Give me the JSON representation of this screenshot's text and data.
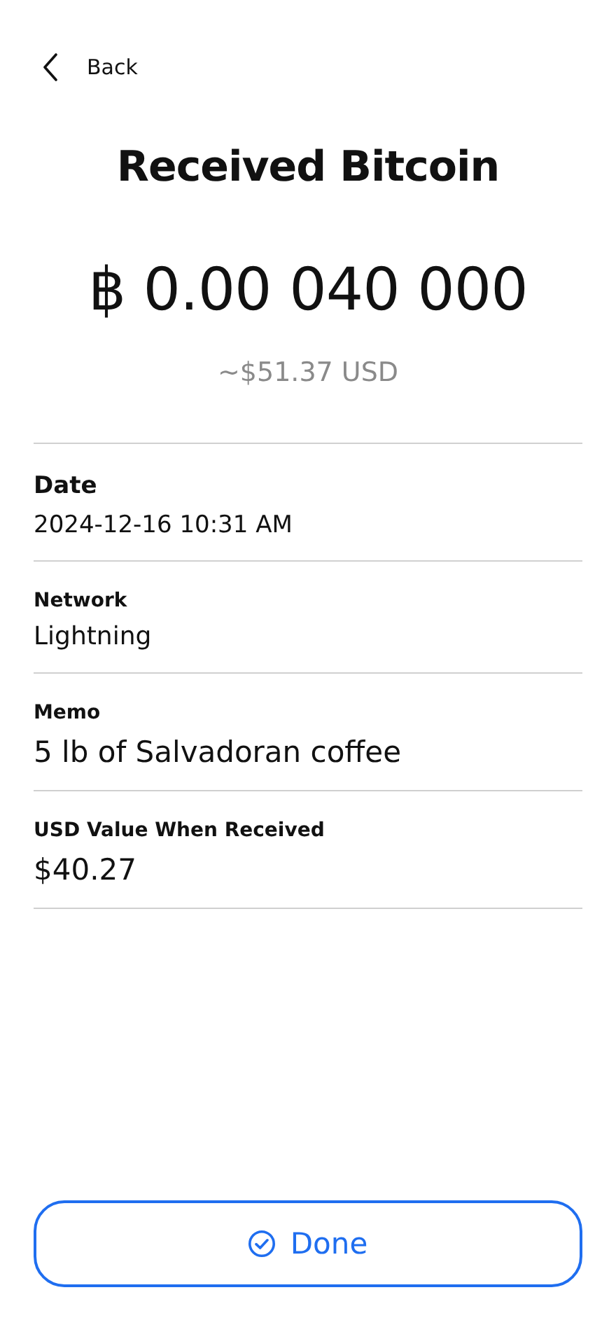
{
  "back": {
    "label": "Back"
  },
  "title": "Received Bitcoin",
  "amount": "฿ 0.00 040 000",
  "fiat_estimate": "~$51.37 USD",
  "details": [
    {
      "label": "Date",
      "value": "2024-12-16  10:31 AM"
    },
    {
      "label": "Network",
      "value": "Lightning"
    },
    {
      "label": "Memo",
      "value": "5 lb of Salvadoran coffee"
    },
    {
      "label": "USD Value When Received",
      "value": "$40.27"
    }
  ],
  "done_button": {
    "label": "Done"
  }
}
